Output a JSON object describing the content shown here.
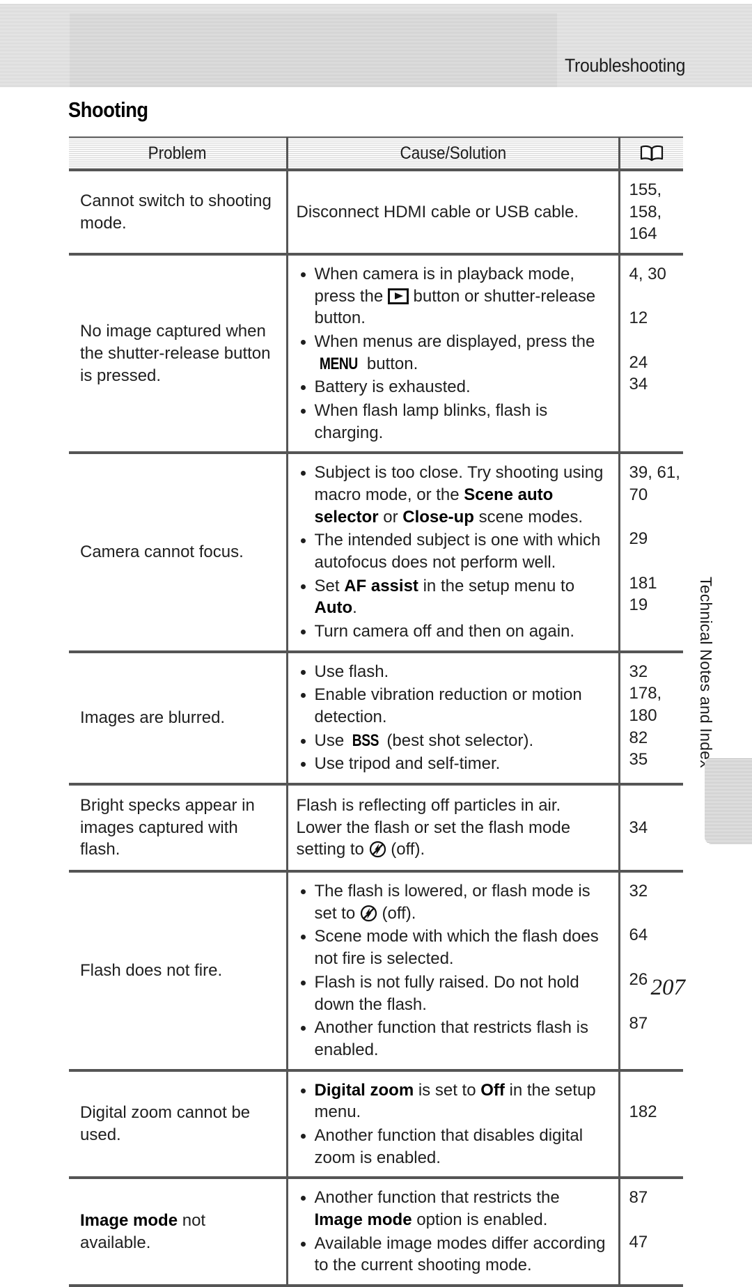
{
  "header": {
    "running_title": "Troubleshooting"
  },
  "section": {
    "heading": "Shooting"
  },
  "table": {
    "columns": [
      {
        "label": "Problem"
      },
      {
        "label": "Cause/Solution"
      },
      {
        "label": "",
        "icon": "book-icon"
      }
    ],
    "rows": [
      {
        "problem": "Cannot switch to shooting mode.",
        "cause_plain": "Disconnect HDMI cable or USB cable.",
        "refs": [
          "155,",
          "158,",
          "164"
        ]
      },
      {
        "problem": "No image captured when the shutter-release button is pressed.",
        "bullets": [
          {
            "pre": "When camera is in playback mode, press the ",
            "icon": "playback-button-icon",
            "post": " button or shutter-release button.",
            "ref": "4, 30"
          },
          {
            "pre": "When menus are displayed, press the ",
            "glyph": "MENU",
            "post": " button.",
            "ref": "12"
          },
          {
            "pre": "Battery is exhausted.",
            "ref": "24"
          },
          {
            "pre": "When flash lamp blinks, flash is charging.",
            "ref": "34"
          }
        ]
      },
      {
        "problem": "Camera cannot focus.",
        "bullets": [
          {
            "pre": "Subject is too close. Try shooting using macro mode, or the ",
            "bold": "Scene auto selector",
            "mid": " or ",
            "bold2": "Close-up",
            "post": " scene modes.",
            "ref": "39, 61,",
            "ref2": "70"
          },
          {
            "pre": "The intended subject is one with which autofocus does not perform well.",
            "ref": "29"
          },
          {
            "pre": "Set ",
            "bold": "AF assist",
            "mid": " in the setup menu to ",
            "bold2": "Auto",
            "post": ".",
            "ref": "181"
          },
          {
            "pre": "Turn camera off and then on again.",
            "ref": "19"
          }
        ]
      },
      {
        "problem": "Images are blurred.",
        "bullets": [
          {
            "pre": "Use flash.",
            "ref": "32"
          },
          {
            "pre": "Enable vibration reduction or motion detection.",
            "ref": "178,",
            "ref2": "180"
          },
          {
            "pre": "Use ",
            "glyph": "BSS",
            "post": " (best shot selector).",
            "ref": "82"
          },
          {
            "pre": "Use tripod and self-timer.",
            "ref": "35"
          }
        ]
      },
      {
        "problem": "Bright specks appear in images captured with flash.",
        "cause_pre": "Flash is reflecting off particles in air. Lower the flash or set the flash mode setting to ",
        "cause_icon": "flash-off-icon",
        "cause_post": " (off).",
        "refs": [
          "34"
        ]
      },
      {
        "problem": "Flash does not fire.",
        "bullets": [
          {
            "pre": "The flash is lowered, or flash mode is set to ",
            "icon": "flash-off-icon",
            "post": " (off).",
            "ref": "32"
          },
          {
            "pre": "Scene mode with which the flash does not fire is selected.",
            "ref": "64"
          },
          {
            "pre": "Flash is not fully raised. Do not hold down the flash.",
            "ref": "26"
          },
          {
            "pre": "Another function that restricts flash is enabled.",
            "ref": "87"
          }
        ]
      },
      {
        "problem": "Digital zoom cannot be used.",
        "bullets": [
          {
            "bold": "Digital zoom",
            "mid": " is set to ",
            "bold2": "Off",
            "post": " in the setup menu.",
            "ref": ""
          },
          {
            "pre": "Another function that disables digital zoom is enabled.",
            "ref": "182"
          }
        ]
      },
      {
        "problem_bold": "Image mode",
        "problem_rest": " not available.",
        "bullets": [
          {
            "pre": "Another function that restricts the ",
            "bold": "Image mode",
            "post": " option is enabled.",
            "ref": "87"
          },
          {
            "pre": "Available image modes differ according to the current shooting mode.",
            "ref": "47"
          }
        ]
      }
    ]
  },
  "chapter_tab": {
    "label": "Technical Notes and Index"
  },
  "page": {
    "number": "207"
  }
}
